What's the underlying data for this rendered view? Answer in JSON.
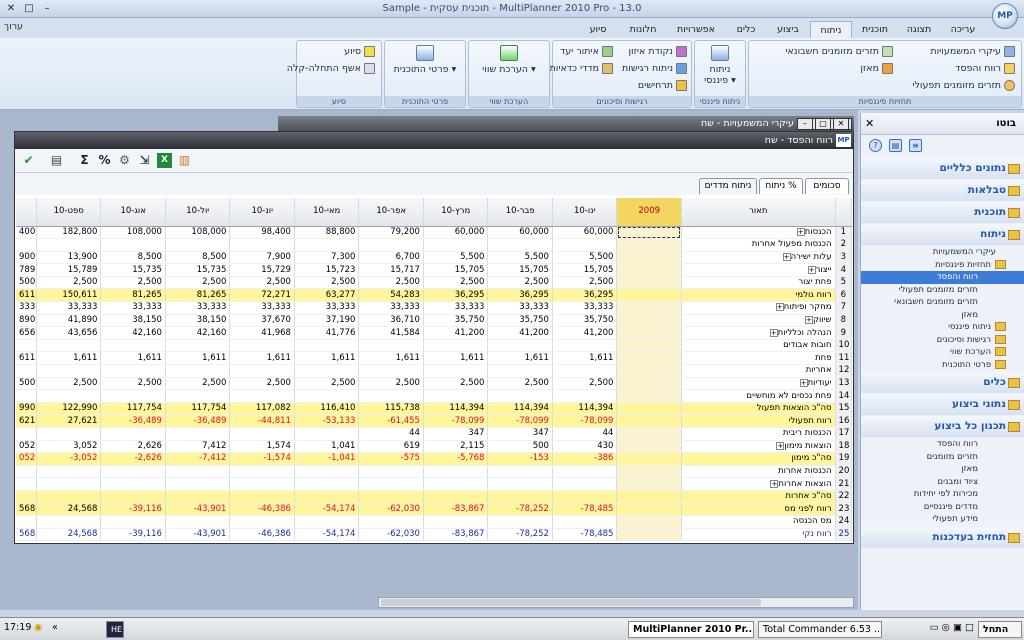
{
  "window": {
    "title": "Sample - תוכנית עסקית - MultiPlanner 2010 Pro - 13.0"
  },
  "logo": "MP",
  "tabs": [
    "עריכה",
    "תצוגה",
    "תוכנית",
    "ניתוח",
    "ביצוע",
    "כלים",
    "אפשרויות",
    "חלונות",
    "סיוע"
  ],
  "active_tab": "ניתוח",
  "edit_menu": "ערוך",
  "ribbon": {
    "groups": [
      {
        "label": "תחזיות פיננסיות",
        "items": [
          "עיקרי המשמעויות",
          "תזרים מזומנים חשבונאי",
          "רווח והפסד",
          "מאזן",
          "תזרים מזומנים תפעולי"
        ]
      },
      {
        "label": "ניתוח פיננסי",
        "big": "ניתוח פיננסי"
      },
      {
        "label": "רגישות וסיכונים",
        "items": [
          "נקודת איזון",
          "איתור יעד",
          "ניתוח רגישות",
          "מדדי כדאיות",
          "תרחישים"
        ]
      },
      {
        "label": "הערכת שווי",
        "big": "הערכת שווי"
      },
      {
        "label": "פרטי התוכנית",
        "big": "פרטי התוכנית"
      },
      {
        "label": "סיוע",
        "items": [
          "סיוע",
          "אשף התחלה-קלה"
        ]
      }
    ]
  },
  "back_window": {
    "title": "עיקרי המשמעויות - שח"
  },
  "main_window": {
    "title": "רווח והפסד - שח"
  },
  "subtabs": [
    "סכומים",
    "ניתוח %",
    "ניתוח מדדים"
  ],
  "grid": {
    "headers": [
      "תאור",
      "2009",
      "ינו-10",
      "פבר-10",
      "מרץ-10",
      "אפר-10",
      "מאי-10",
      "יונ-10",
      "יול-10",
      "אוג-10",
      "ספט-10"
    ],
    "rows": [
      {
        "n": "1",
        "d": "הכנסות",
        "p": 1,
        "v": [
          "",
          "60,000",
          "60,000",
          "60,000",
          "79,200",
          "88,800",
          "98,400",
          "108,000",
          "108,000",
          "182,800"
        ],
        "e": "400"
      },
      {
        "n": "2",
        "d": "הכנסות מפעול אחרות",
        "v": [
          "",
          "",
          "",
          "",
          "",
          "",
          "",
          "",
          "",
          ""
        ],
        "e": ""
      },
      {
        "n": "3",
        "d": "עלות ישירה",
        "p": 1,
        "v": [
          "",
          "5,500",
          "5,500",
          "5,500",
          "6,700",
          "7,300",
          "7,900",
          "8,500",
          "8,500",
          "13,900"
        ],
        "e": "900"
      },
      {
        "n": "4",
        "d": "ייצור",
        "p": 1,
        "v": [
          "",
          "15,705",
          "15,705",
          "15,705",
          "15,717",
          "15,723",
          "15,729",
          "15,735",
          "15,735",
          "15,789"
        ],
        "e": "789"
      },
      {
        "n": "5",
        "d": "פחת יצור",
        "v": [
          "",
          "2,500",
          "2,500",
          "2,500",
          "2,500",
          "2,500",
          "2,500",
          "2,500",
          "2,500",
          "2,500"
        ],
        "e": "500"
      },
      {
        "n": "6",
        "d": "רווח גולמי",
        "hl": 1,
        "v": [
          "",
          "36,295",
          "36,295",
          "36,295",
          "54,283",
          "63,277",
          "72,271",
          "81,265",
          "81,265",
          "150,611"
        ],
        "e": "611"
      },
      {
        "n": "7",
        "d": "מחקר ופיתוח",
        "p": 1,
        "v": [
          "",
          "33,333",
          "33,333",
          "33,333",
          "33,333",
          "33,333",
          "33,333",
          "33,333",
          "33,333",
          "33,333"
        ],
        "e": "333"
      },
      {
        "n": "8",
        "d": "שיווק",
        "p": 1,
        "v": [
          "",
          "35,750",
          "35,750",
          "35,750",
          "36,710",
          "37,190",
          "37,670",
          "38,150",
          "38,150",
          "41,890"
        ],
        "e": "890"
      },
      {
        "n": "9",
        "d": "הנהלה וכלליות",
        "p": 1,
        "v": [
          "",
          "41,200",
          "41,200",
          "41,200",
          "41,584",
          "41,776",
          "41,968",
          "42,160",
          "42,160",
          "43,656"
        ],
        "e": "656"
      },
      {
        "n": "10",
        "d": "חובות אבודים",
        "v": [
          "",
          "",
          "",
          "",
          "",
          "",
          "",
          "",
          "",
          ""
        ],
        "e": ""
      },
      {
        "n": "11",
        "d": "פחת",
        "v": [
          "",
          "1,611",
          "1,611",
          "1,611",
          "1,611",
          "1,611",
          "1,611",
          "1,611",
          "1,611",
          "1,611"
        ],
        "e": "611"
      },
      {
        "n": "12",
        "d": "אחריות",
        "v": [
          "",
          "",
          "",
          "",
          "",
          "",
          "",
          "",
          "",
          ""
        ],
        "e": ""
      },
      {
        "n": "13",
        "d": "יעודיות",
        "p": 1,
        "v": [
          "",
          "2,500",
          "2,500",
          "2,500",
          "2,500",
          "2,500",
          "2,500",
          "2,500",
          "2,500",
          "2,500"
        ],
        "e": "500"
      },
      {
        "n": "14",
        "d": "פחת נכסים לא מוחשיים",
        "v": [
          "",
          "",
          "",
          "",
          "",
          "",
          "",
          "",
          "",
          ""
        ],
        "e": ""
      },
      {
        "n": "15",
        "d": "סה\"כ הוצאות תפעול",
        "hl": 1,
        "v": [
          "",
          "114,394",
          "114,394",
          "114,394",
          "115,738",
          "116,410",
          "117,082",
          "117,754",
          "117,754",
          "122,990"
        ],
        "e": "990"
      },
      {
        "n": "16",
        "d": "רווח תפעולי",
        "hl": 1,
        "v": [
          "",
          "-78,099",
          "-78,099",
          "-78,099",
          "-61,455",
          "-53,133",
          "-44,811",
          "-36,489",
          "-36,489",
          "27,621"
        ],
        "e": "621"
      },
      {
        "n": "17",
        "d": "הכנסות ריבית",
        "v": [
          "",
          "44",
          "347",
          "347",
          "44",
          "",
          "",
          "",
          "",
          ""
        ],
        "e": ""
      },
      {
        "n": "18",
        "d": "הוצאות מימון",
        "p": 1,
        "v": [
          "",
          "430",
          "500",
          "2,115",
          "619",
          "1,041",
          "1,574",
          "7,412",
          "2,626",
          "3,052"
        ],
        "e": "052"
      },
      {
        "n": "19",
        "d": "סה\"כ מימון",
        "hl": 1,
        "v": [
          "",
          "-386",
          "-153",
          "-5,768",
          "-575",
          "-1,041",
          "-1,574",
          "-7,412",
          "-2,626",
          "-3,052"
        ],
        "e": "052"
      },
      {
        "n": "20",
        "d": "הכנסות אחרות",
        "v": [
          "",
          "",
          "",
          "",
          "",
          "",
          "",
          "",
          "",
          ""
        ],
        "e": ""
      },
      {
        "n": "21",
        "d": "הוצאות אחרות",
        "p": 1,
        "v": [
          "",
          "",
          "",
          "",
          "",
          "",
          "",
          "",
          "",
          ""
        ],
        "e": ""
      },
      {
        "n": "22",
        "d": "סה\"כ אחרות",
        "hl": 1,
        "v": [
          "",
          "",
          "",
          "",
          "",
          "",
          "",
          "",
          "",
          ""
        ],
        "e": ""
      },
      {
        "n": "23",
        "d": "רווח לפני מס",
        "hl": 1,
        "v": [
          "",
          "-78,485",
          "-78,252",
          "-83,867",
          "-62,030",
          "-54,174",
          "-46,386",
          "-43,901",
          "-39,116",
          "24,568"
        ],
        "e": "568"
      },
      {
        "n": "24",
        "d": "מס הכנסה",
        "v": [
          "",
          "",
          "",
          "",
          "",
          "",
          "",
          "",
          "",
          ""
        ],
        "e": ""
      },
      {
        "n": "25",
        "d": "רווח נקי",
        "net": 1,
        "v": [
          "",
          "-78,485",
          "-78,252",
          "-83,867",
          "-62,030",
          "-54,174",
          "-46,386",
          "-43,901",
          "-39,116",
          "24,568"
        ],
        "e": "568"
      }
    ]
  },
  "sidebar": {
    "title": "בוטו",
    "categories": [
      "נתונים כלליים",
      "טבלאות",
      "תוכנית",
      "ניתוח",
      "כלים",
      "נתוני ביצוע",
      "תכנון כל ביצוע",
      "תחזית בעדכנות"
    ],
    "analysis_items": [
      {
        "t": "עיקרי המשמעויות",
        "k": "l1"
      },
      {
        "t": "תחזיות פיננסיות",
        "k": "fold"
      },
      {
        "t": "רווח והפסד",
        "k": "l2 sel"
      },
      {
        "t": "תזרים מזומנים תפעולי",
        "k": "l2"
      },
      {
        "t": "תזרים מזומנים חשבונאי",
        "k": "l2"
      },
      {
        "t": "מאזן",
        "k": "l2"
      },
      {
        "t": "ניתוח פיננסי",
        "k": "fold"
      },
      {
        "t": "רגישות וסיכונים",
        "k": "fold"
      },
      {
        "t": "הערכת שווי",
        "k": "fold"
      },
      {
        "t": "פרטי התוכנית",
        "k": "fold"
      }
    ],
    "exec_items": [
      "רווח והפסד",
      "תזרים מזומנים",
      "מאזן",
      "ציוד ומבנים",
      "מכירות לפי יחידות",
      "מדדים פיננסיים",
      "מידע תפעולי"
    ]
  },
  "taskbar": {
    "start": "התחל",
    "items": [
      "MultiPlanner 2010 Pr...",
      "Total Commander 6.53 ...",
      "HE"
    ],
    "clock": "17:19"
  }
}
